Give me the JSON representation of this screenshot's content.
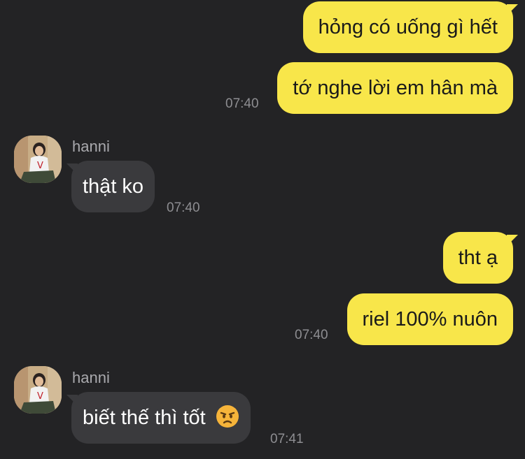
{
  "messages": {
    "out1": {
      "text": "hỏng có uống gì hết"
    },
    "out2": {
      "text": "tớ nghe lời em hân mà",
      "time": "07:40"
    },
    "in1": {
      "sender": "hanni",
      "text": "thật ko",
      "time": "07:40"
    },
    "out3": {
      "text": "tht ạ"
    },
    "out4": {
      "text": "riel 100% nuôn",
      "time": "07:40"
    },
    "in2": {
      "sender": "hanni",
      "text": "biết thế thì tốt",
      "emoji": "pouting-face-icon",
      "time": "07:41"
    }
  },
  "colors": {
    "background": "#232325",
    "outgoing_bubble": "#F8E64A",
    "incoming_bubble": "#3A3A3D",
    "timestamp": "#8E8E92"
  }
}
